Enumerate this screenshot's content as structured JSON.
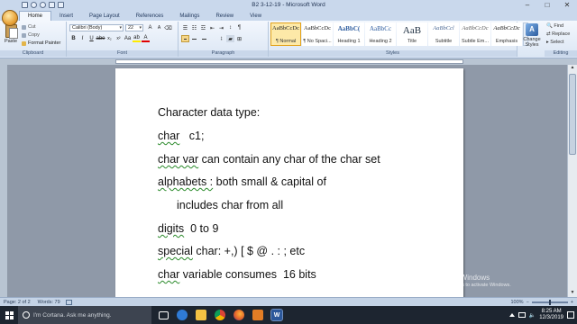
{
  "window": {
    "title": "B2 3-12-19 - Microsoft Word",
    "minimize": "–",
    "maximize": "□",
    "close": "✕"
  },
  "tabs": [
    "Home",
    "Insert",
    "Page Layout",
    "References",
    "Mailings",
    "Review",
    "View"
  ],
  "clipboard": {
    "paste": "Paste",
    "cut": "Cut",
    "copy": "Copy",
    "format_painter": "Format Painter",
    "label": "Clipboard"
  },
  "font": {
    "name": "Calibri (Body)",
    "size": "22",
    "label": "Font"
  },
  "paragraph": {
    "label": "Paragraph"
  },
  "styles": {
    "label": "Styles",
    "items": [
      {
        "preview": "AaBbCcDc",
        "name": "¶ Normal"
      },
      {
        "preview": "AaBbCcDc",
        "name": "¶ No Spaci..."
      },
      {
        "preview": "AaBbC(",
        "name": "Heading 1"
      },
      {
        "preview": "AaBbCc",
        "name": "Heading 2"
      },
      {
        "preview": "AaB",
        "name": "Title"
      },
      {
        "preview": "AaBbCcl",
        "name": "Subtitle"
      },
      {
        "preview": "AaBbCcDc",
        "name": "Subtle Em..."
      },
      {
        "preview": "AaBbCcDc",
        "name": "Emphasis"
      }
    ],
    "change_styles": "Change Styles"
  },
  "editing": {
    "label": "Editing",
    "find": "Find",
    "replace": "Replace",
    "select": "Select"
  },
  "document": {
    "lines": [
      "Character data type:",
      "char   c1;",
      "char var can contain any char of the char set",
      "alphabets : both small & capital of",
      "includes char from all",
      "digits  0 to 9",
      "special char: +,) [ $ @ . : ; etc",
      "char variable consumes  16 bits"
    ]
  },
  "watermark": {
    "title": "Activate Windows",
    "subtitle": "Go to Settings to activate Windows."
  },
  "statusbar": {
    "page": "Page: 2 of 2",
    "words": "Words: 79",
    "zoom": "100%"
  },
  "taskbar": {
    "search_placeholder": "I'm Cortana. Ask me anything.",
    "time": "8:25 AM",
    "date": "12/3/2019"
  }
}
